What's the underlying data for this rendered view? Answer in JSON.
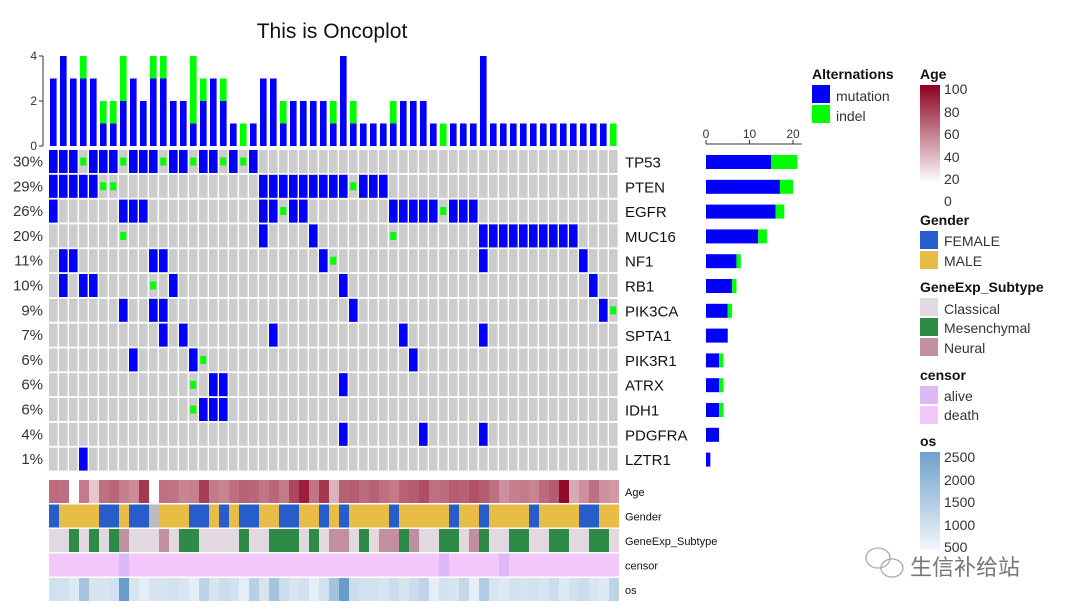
{
  "chart_data": {
    "type": "heatmap",
    "title": "This is Oncoplot",
    "genes": [
      "TP53",
      "PTEN",
      "EGFR",
      "MUC16",
      "NF1",
      "RB1",
      "PIK3CA",
      "SPTA1",
      "PIK3R1",
      "ATRX",
      "IDH1",
      "PDGFRA",
      "LZTR1"
    ],
    "percentages": [
      "30%",
      "29%",
      "26%",
      "20%",
      "11%",
      "10%",
      "9%",
      "7%",
      "6%",
      "6%",
      "6%",
      "4%",
      "1%"
    ],
    "n_samples": 57,
    "alteration_codes": {
      "0": "none",
      "1": "mutation",
      "2": "indel"
    },
    "matrix": [
      [
        1,
        1,
        1,
        2,
        1,
        1,
        1,
        2,
        1,
        1,
        1,
        2,
        1,
        1,
        2,
        1,
        1,
        2,
        1,
        2,
        1,
        0,
        0,
        0,
        0,
        0,
        0,
        0,
        0,
        0,
        0,
        0,
        0,
        0,
        0,
        0,
        0,
        0,
        0,
        0,
        0,
        0,
        0,
        0,
        0,
        0,
        0,
        0,
        0,
        0,
        0,
        0,
        0,
        0,
        0,
        0,
        0
      ],
      [
        1,
        1,
        1,
        1,
        1,
        2,
        2,
        0,
        0,
        0,
        0,
        0,
        0,
        0,
        0,
        0,
        0,
        0,
        0,
        0,
        0,
        1,
        1,
        1,
        1,
        1,
        1,
        1,
        1,
        1,
        2,
        1,
        1,
        1,
        0,
        0,
        0,
        0,
        0,
        0,
        0,
        0,
        0,
        0,
        0,
        0,
        0,
        0,
        0,
        0,
        0,
        0,
        0,
        0,
        0,
        0,
        0
      ],
      [
        1,
        0,
        0,
        0,
        0,
        0,
        0,
        1,
        1,
        1,
        0,
        0,
        0,
        0,
        0,
        0,
        0,
        0,
        0,
        0,
        0,
        1,
        1,
        2,
        1,
        1,
        0,
        0,
        0,
        0,
        0,
        0,
        0,
        0,
        1,
        1,
        1,
        1,
        1,
        2,
        1,
        1,
        1,
        0,
        0,
        0,
        0,
        0,
        0,
        0,
        0,
        0,
        0,
        0,
        0,
        0,
        0
      ],
      [
        0,
        0,
        0,
        0,
        0,
        0,
        0,
        2,
        0,
        0,
        0,
        0,
        0,
        0,
        0,
        0,
        0,
        0,
        0,
        0,
        0,
        1,
        0,
        0,
        0,
        0,
        1,
        0,
        0,
        0,
        0,
        0,
        0,
        0,
        2,
        0,
        0,
        0,
        0,
        0,
        0,
        0,
        0,
        1,
        1,
        1,
        1,
        1,
        1,
        1,
        1,
        1,
        1,
        0,
        0,
        0,
        0
      ],
      [
        0,
        1,
        1,
        0,
        0,
        0,
        0,
        0,
        0,
        0,
        1,
        1,
        0,
        0,
        0,
        0,
        0,
        0,
        0,
        0,
        0,
        0,
        0,
        0,
        0,
        0,
        0,
        1,
        2,
        0,
        0,
        0,
        0,
        0,
        0,
        0,
        0,
        0,
        0,
        0,
        0,
        0,
        0,
        1,
        0,
        0,
        0,
        0,
        0,
        0,
        0,
        0,
        0,
        1,
        0,
        0,
        0
      ],
      [
        0,
        1,
        0,
        1,
        1,
        0,
        0,
        0,
        0,
        0,
        2,
        0,
        1,
        0,
        0,
        0,
        0,
        0,
        0,
        0,
        0,
        0,
        0,
        0,
        0,
        0,
        0,
        0,
        0,
        1,
        0,
        0,
        0,
        0,
        0,
        0,
        0,
        0,
        0,
        0,
        0,
        0,
        0,
        0,
        0,
        0,
        0,
        0,
        0,
        0,
        0,
        0,
        0,
        0,
        1,
        0,
        0
      ],
      [
        0,
        0,
        0,
        0,
        0,
        0,
        0,
        1,
        0,
        0,
        1,
        1,
        0,
        0,
        0,
        0,
        0,
        0,
        0,
        0,
        0,
        0,
        0,
        0,
        0,
        0,
        0,
        0,
        0,
        0,
        1,
        0,
        0,
        0,
        0,
        0,
        0,
        0,
        0,
        0,
        0,
        0,
        0,
        0,
        0,
        0,
        0,
        0,
        0,
        0,
        0,
        0,
        0,
        0,
        0,
        1,
        2
      ],
      [
        0,
        0,
        0,
        0,
        0,
        0,
        0,
        0,
        0,
        0,
        0,
        1,
        0,
        1,
        0,
        0,
        0,
        0,
        0,
        0,
        0,
        0,
        1,
        0,
        0,
        0,
        0,
        0,
        0,
        0,
        0,
        0,
        0,
        0,
        0,
        1,
        0,
        0,
        0,
        0,
        0,
        0,
        0,
        1,
        0,
        0,
        0,
        0,
        0,
        0,
        0,
        0,
        0,
        0,
        0,
        0,
        0
      ],
      [
        0,
        0,
        0,
        0,
        0,
        0,
        0,
        0,
        1,
        0,
        0,
        0,
        0,
        0,
        1,
        2,
        0,
        0,
        0,
        0,
        0,
        0,
        0,
        0,
        0,
        0,
        0,
        0,
        0,
        0,
        0,
        0,
        0,
        0,
        0,
        0,
        1,
        0,
        0,
        0,
        0,
        0,
        0,
        0,
        0,
        0,
        0,
        0,
        0,
        0,
        0,
        0,
        0,
        0,
        0,
        0,
        0
      ],
      [
        0,
        0,
        0,
        0,
        0,
        0,
        0,
        0,
        0,
        0,
        0,
        0,
        0,
        0,
        2,
        0,
        1,
        1,
        0,
        0,
        0,
        0,
        0,
        0,
        0,
        0,
        0,
        0,
        0,
        1,
        0,
        0,
        0,
        0,
        0,
        0,
        0,
        0,
        0,
        0,
        0,
        0,
        0,
        0,
        0,
        0,
        0,
        0,
        0,
        0,
        0,
        0,
        0,
        0,
        0,
        0,
        0
      ],
      [
        0,
        0,
        0,
        0,
        0,
        0,
        0,
        0,
        0,
        0,
        0,
        0,
        0,
        0,
        2,
        1,
        1,
        1,
        0,
        0,
        0,
        0,
        0,
        0,
        0,
        0,
        0,
        0,
        0,
        0,
        0,
        0,
        0,
        0,
        0,
        0,
        0,
        0,
        0,
        0,
        0,
        0,
        0,
        0,
        0,
        0,
        0,
        0,
        0,
        0,
        0,
        0,
        0,
        0,
        0,
        0,
        0
      ],
      [
        0,
        0,
        0,
        0,
        0,
        0,
        0,
        0,
        0,
        0,
        0,
        0,
        0,
        0,
        0,
        0,
        0,
        0,
        0,
        0,
        0,
        0,
        0,
        0,
        0,
        0,
        0,
        0,
        0,
        1,
        0,
        0,
        0,
        0,
        0,
        0,
        0,
        1,
        0,
        0,
        0,
        0,
        0,
        1,
        0,
        0,
        0,
        0,
        0,
        0,
        0,
        0,
        0,
        0,
        0,
        0,
        0
      ],
      [
        0,
        0,
        0,
        1,
        0,
        0,
        0,
        0,
        0,
        0,
        0,
        0,
        0,
        0,
        0,
        0,
        0,
        0,
        0,
        0,
        0,
        0,
        0,
        0,
        0,
        0,
        0,
        0,
        0,
        0,
        0,
        0,
        0,
        0,
        0,
        0,
        0,
        0,
        0,
        0,
        0,
        0,
        0,
        0,
        0,
        0,
        0,
        0,
        0,
        0,
        0,
        0,
        0,
        0,
        0,
        0,
        0
      ]
    ],
    "top_bar": {
      "ylim": [
        0,
        4
      ],
      "ticks": [
        "0",
        "2",
        "4"
      ],
      "mutation": [
        3,
        4,
        3,
        3,
        3,
        1,
        1,
        2,
        3,
        2,
        3,
        3,
        2,
        2,
        1,
        2,
        3,
        2,
        1,
        0,
        1,
        3,
        3,
        1,
        2,
        2,
        2,
        2,
        1,
        4,
        1,
        1,
        1,
        1,
        1,
        2,
        2,
        2,
        1,
        0,
        1,
        1,
        1,
        4,
        1,
        1,
        1,
        1,
        1,
        1,
        1,
        1,
        1,
        1,
        1,
        1,
        0
      ],
      "indel": [
        0,
        0,
        0,
        1,
        0,
        1,
        1,
        2,
        0,
        0,
        1,
        1,
        0,
        0,
        3,
        1,
        0,
        1,
        0,
        1,
        0,
        0,
        0,
        1,
        0,
        0,
        0,
        0,
        1,
        0,
        1,
        0,
        0,
        0,
        1,
        0,
        0,
        0,
        0,
        1,
        0,
        0,
        0,
        0,
        0,
        0,
        0,
        0,
        0,
        0,
        0,
        0,
        0,
        0,
        0,
        0,
        1
      ]
    },
    "right_bar": {
      "xlim": [
        0,
        22
      ],
      "ticks": [
        "0",
        "10",
        "20"
      ],
      "mutation": [
        15,
        17,
        16,
        12,
        7,
        6,
        5,
        5,
        3,
        3,
        3,
        3,
        1
      ],
      "indel": [
        6,
        3,
        2,
        2,
        1,
        1,
        1,
        0,
        1,
        1,
        1,
        0,
        0
      ]
    },
    "annotations": {
      "labels": [
        "Age",
        "Gender",
        "GeneExp_Subtype",
        "censor",
        "os"
      ],
      "age": [
        58,
        56,
        null,
        52,
        22,
        56,
        60,
        50,
        46,
        78,
        null,
        56,
        54,
        48,
        50,
        76,
        52,
        48,
        56,
        62,
        60,
        54,
        60,
        52,
        72,
        88,
        54,
        78,
        30,
        62,
        64,
        58,
        62,
        56,
        52,
        62,
        64,
        70,
        56,
        58,
        64,
        62,
        68,
        64,
        56,
        44,
        50,
        52,
        48,
        58,
        64,
        96,
        34,
        44,
        56,
        44,
        40
      ],
      "gender": [
        "F",
        "M",
        "M",
        "M",
        "M",
        "F",
        "F",
        "M",
        "F",
        "F",
        "N",
        "M",
        "M",
        "M",
        "F",
        "F",
        "M",
        "F",
        "M",
        "F",
        "F",
        "M",
        "M",
        "F",
        "F",
        "M",
        "M",
        "F",
        "M",
        "F",
        "M",
        "M",
        "M",
        "M",
        "F",
        "M",
        "M",
        "M",
        "M",
        "M",
        "F",
        "M",
        "M",
        "F",
        "M",
        "M",
        "M",
        "M",
        "F",
        "M",
        "M",
        "M",
        "M",
        "F",
        "F",
        "M",
        "M"
      ],
      "subtype": [
        "C",
        "C",
        "M",
        "C",
        "M",
        "C",
        "M",
        "N",
        "C",
        "C",
        "C",
        "N",
        "C",
        "M",
        "M",
        "C",
        "C",
        "C",
        "C",
        "M",
        "C",
        "C",
        "M",
        "M",
        "M",
        "C",
        "M",
        "C",
        "N",
        "N",
        "C",
        "M",
        "C",
        "N",
        "N",
        "M",
        "N",
        "C",
        "C",
        "M",
        "M",
        "C",
        "N",
        "M",
        "C",
        "C",
        "M",
        "M",
        "C",
        "C",
        "M",
        "M",
        "C",
        "C",
        "M",
        "M",
        "C"
      ],
      "censor": [
        "d",
        "d",
        "d",
        "d",
        "d",
        "d",
        "d",
        "a",
        "d",
        "d",
        "d",
        "d",
        "d",
        "d",
        "d",
        "d",
        "d",
        "d",
        "d",
        "d",
        "d",
        "d",
        "d",
        "d",
        "d",
        "d",
        "d",
        "d",
        "d",
        "d",
        "d",
        "d",
        "d",
        "d",
        "d",
        "d",
        "d",
        "d",
        "d",
        "a",
        "d",
        "d",
        "d",
        "d",
        "d",
        "a",
        "d",
        "d",
        "d",
        "d",
        "d",
        "d",
        "d",
        "d",
        "d",
        "d",
        "d"
      ],
      "os": [
        700,
        700,
        500,
        1400,
        600,
        600,
        700,
        2300,
        600,
        400,
        600,
        600,
        700,
        600,
        400,
        1000,
        600,
        800,
        700,
        400,
        1100,
        600,
        1400,
        800,
        600,
        700,
        400,
        700,
        1400,
        2300,
        800,
        700,
        700,
        600,
        800,
        600,
        800,
        1000,
        400,
        700,
        600,
        900,
        400,
        1200,
        600,
        500,
        700,
        600,
        700,
        600,
        800,
        500,
        700,
        800,
        600,
        500,
        1000
      ]
    },
    "colors": {
      "mutation": "#0000ff",
      "indel": "#00ff00",
      "empty": "#cccccc",
      "female": "#265dca",
      "male": "#e8bc45",
      "gender_na": "#bbbbbb",
      "classical": "#e2d8e0",
      "mesenchymal": "#2e8b45",
      "neural": "#c090a0",
      "alive": "#ddb8f7",
      "death": "#f2c8fb",
      "age_low": "#ffffff",
      "age_high": "#8b0020",
      "os_low": "#ffffff",
      "os_high": "#5b94c5"
    }
  },
  "legend": {
    "alterations": {
      "title": "Alternations",
      "items": [
        "mutation",
        "indel"
      ]
    },
    "age": {
      "title": "Age",
      "ticks": [
        "100",
        "80",
        "60",
        "40",
        "20",
        "0"
      ]
    },
    "gender": {
      "title": "Gender",
      "items": [
        "FEMALE",
        "MALE"
      ]
    },
    "subtype": {
      "title": "GeneExp_Subtype",
      "items": [
        "Classical",
        "Mesenchymal",
        "Neural"
      ]
    },
    "censor": {
      "title": "censor",
      "items": [
        "alive",
        "death"
      ]
    },
    "os": {
      "title": "os",
      "ticks": [
        "2500",
        "2000",
        "1500",
        "1000",
        "500"
      ]
    }
  },
  "watermark": "生信补给站"
}
